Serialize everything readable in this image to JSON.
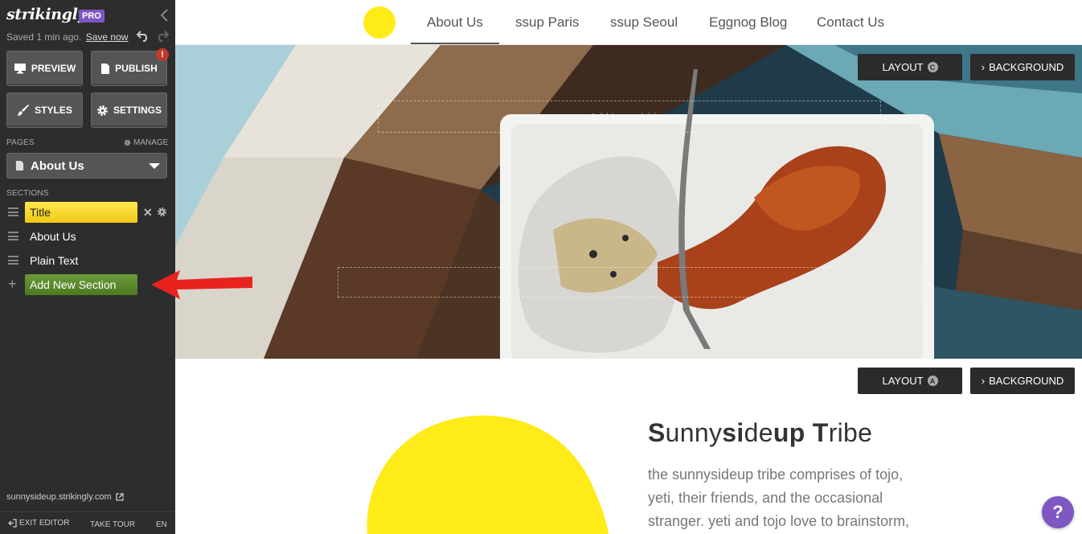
{
  "sidebar": {
    "logo": "strikingly",
    "pro_badge": "PRO",
    "saved_text": "Saved 1 min ago.",
    "save_now": "Save now",
    "buttons": {
      "preview": "PREVIEW",
      "publish": "PUBLISH",
      "publish_alert": "!",
      "styles": "STYLES",
      "settings": "SETTINGS"
    },
    "pages_label": "PAGES",
    "manage_label": "MANAGE",
    "current_page": "About Us",
    "sections_label": "SECTIONS",
    "sections": [
      {
        "label": "Title",
        "active": true
      },
      {
        "label": "About Us"
      },
      {
        "label": "Plain Text"
      }
    ],
    "add_section": "Add New Section",
    "site_url": "sunnysideup.strikingly.com",
    "footer": {
      "exit_editor": "EXIT EDITOR",
      "take_tour": "TAKE TOUR",
      "lang": "EN"
    }
  },
  "nav": {
    "items": [
      "About Us",
      "ssup Paris",
      "ssup Seoul",
      "Eggnog Blog",
      "Contact Us"
    ],
    "active": "About Us",
    "accent": "#ffeb17"
  },
  "hero": {
    "layout_button": "LAYOUT",
    "layout_badge": "C",
    "background_button": "BACKGROUND",
    "add_media_placeholder": "Add image/video."
  },
  "about": {
    "layout_button": "LAYOUT",
    "layout_badge": "A",
    "background_button": "BACKGROUND",
    "title": "Sunnysideup Tribe",
    "body": "the sunnysideup tribe comprises of tojo, yeti, their friends, and the occasional stranger. yeti and tojo love to brainstorm,"
  },
  "help_button": "?",
  "colors": {
    "sidebar_bg": "#2d2d2d",
    "active_section": "#f5d52a",
    "add_section": "#5c8a2e",
    "brand_purple": "#7e57c2",
    "arrow": "#e8231f"
  }
}
